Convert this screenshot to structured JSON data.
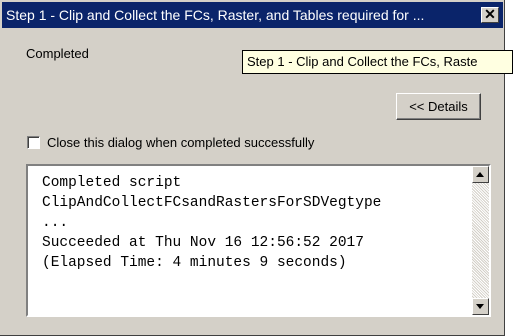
{
  "window": {
    "title": "Step 1 - Clip and Collect the FCs, Raster, and Tables required for ...",
    "close_icon": "close-icon"
  },
  "status_text": "Completed",
  "tooltip": "Step 1 - Clip and Collect the FCs, Raste",
  "buttons": {
    "details_label": "<< Details"
  },
  "checkbox": {
    "label": "Close this dialog when completed successfully",
    "checked": false
  },
  "log": {
    "lines": [
      "Completed script",
      "ClipAndCollectFCsandRastersForSDVegtype",
      "...",
      "Succeeded at Thu Nov 16 12:56:52 2017",
      "(Elapsed Time: 4 minutes 9 seconds)"
    ]
  },
  "colors": {
    "titlebar": "#0a246a",
    "face": "#d4d0c8",
    "tooltip_bg": "#ffffe1"
  }
}
